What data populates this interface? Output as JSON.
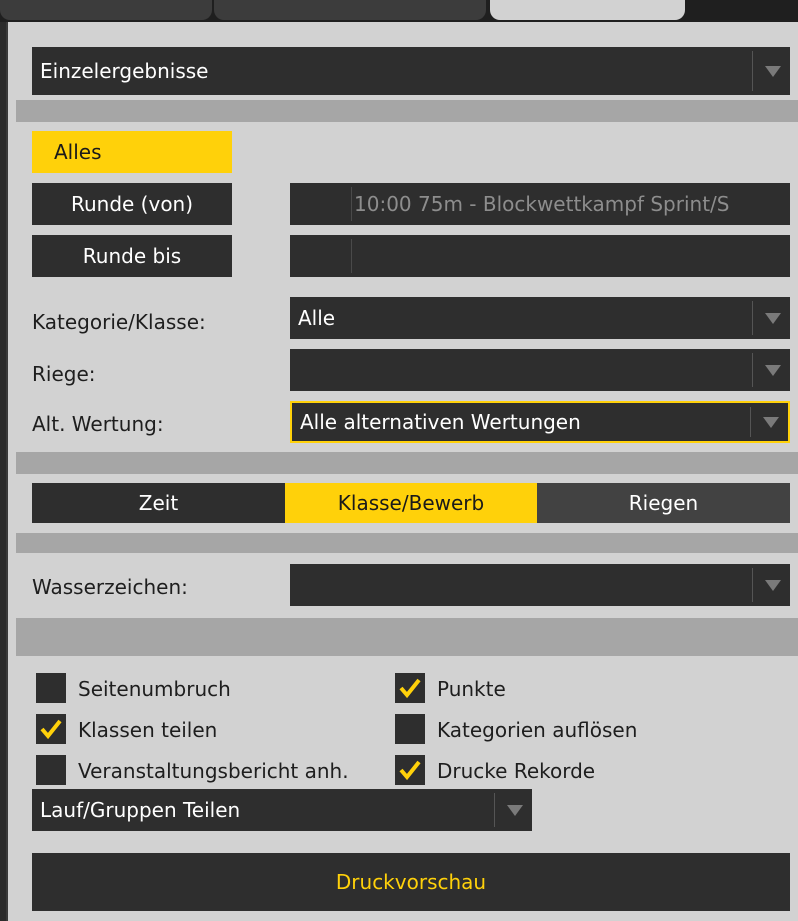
{
  "report_type": {
    "value": "Einzelergebnisse"
  },
  "filters": {
    "all_button": "Alles",
    "round_from_button": "Runde (von)",
    "round_from_value": "10:00 75m - Blockwettkampf Sprint/S",
    "round_to_button": "Runde bis",
    "round_to_value": "",
    "category_label": "Kategorie/Klasse:",
    "category_value": "Alle",
    "squad_label": "Riege:",
    "squad_value": "",
    "alt_scoring_label": "Alt. Wertung:",
    "alt_scoring_value": "Alle alternativen Wertungen"
  },
  "sort_tabs": [
    {
      "label": "Zeit",
      "active": false
    },
    {
      "label": "Klasse/Bewerb",
      "active": true
    },
    {
      "label": "Riegen",
      "active": false
    }
  ],
  "watermark": {
    "label": "Wasserzeichen:",
    "value": ""
  },
  "options": [
    {
      "label": "Seitenumbruch",
      "checked": false
    },
    {
      "label": "Punkte",
      "checked": true
    },
    {
      "label": "Klassen teilen",
      "checked": true
    },
    {
      "label": "Kategorien auflösen",
      "checked": false
    },
    {
      "label": "Veranstaltungsbericht anh.",
      "checked": false
    },
    {
      "label": "Drucke Rekorde",
      "checked": true
    }
  ],
  "split_mode": {
    "value": "Lauf/Gruppen Teilen"
  },
  "print_preview_label": "Druckvorschau",
  "colors": {
    "accent": "#ffd10a",
    "panel": "#d2d2d2",
    "control": "#2e2e2e"
  }
}
